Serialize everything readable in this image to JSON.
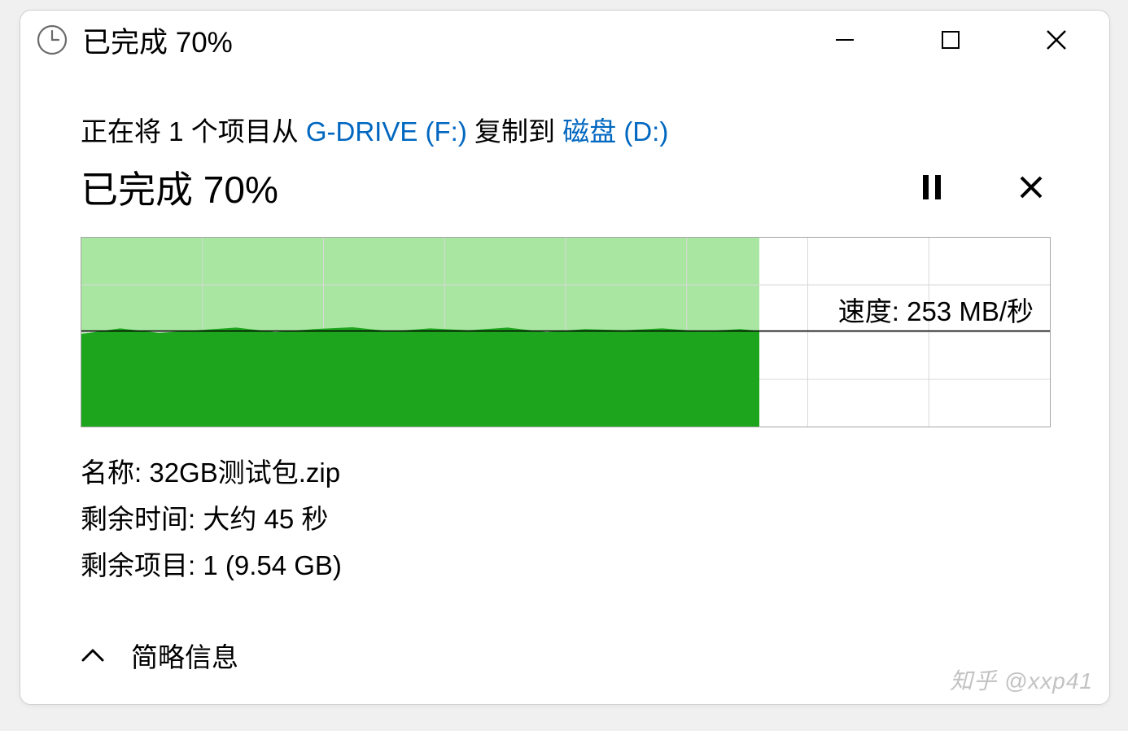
{
  "titlebar": {
    "title": "已完成 70%"
  },
  "copy_line": {
    "prefix": "正在将 1 个项目从 ",
    "source": "G-DRIVE (F:)",
    "middle": " 复制到 ",
    "dest": "磁盘 (D:)"
  },
  "headline": "已完成 70%",
  "speed_label": "速度: 253 MB/秒",
  "details": {
    "name_label": "名称: ",
    "name_value": "32GB测试包.zip",
    "time_label": "剩余时间: ",
    "time_value": "大约 45 秒",
    "items_label": "剩余项目: ",
    "items_value": "1 (9.54 GB)"
  },
  "footer": {
    "toggle_label": "简略信息"
  },
  "watermark": "知乎 @xxp41",
  "chart_data": {
    "type": "area",
    "title": "传输速度",
    "xlabel": "",
    "ylabel": "MB/秒",
    "ylim": [
      0,
      500
    ],
    "progress_pct": 70,
    "current_speed": 253,
    "grid_rows": 4,
    "grid_cols": 8,
    "series": [
      {
        "name": "speed",
        "x_pct": [
          0,
          4,
          8,
          12,
          16,
          20,
          24,
          28,
          32,
          36,
          40,
          44,
          48,
          52,
          56,
          60,
          64,
          68,
          70
        ],
        "values": [
          245,
          260,
          248,
          255,
          262,
          250,
          258,
          263,
          252,
          260,
          255,
          262,
          250,
          258,
          255,
          260,
          252,
          258,
          253
        ]
      }
    ]
  }
}
